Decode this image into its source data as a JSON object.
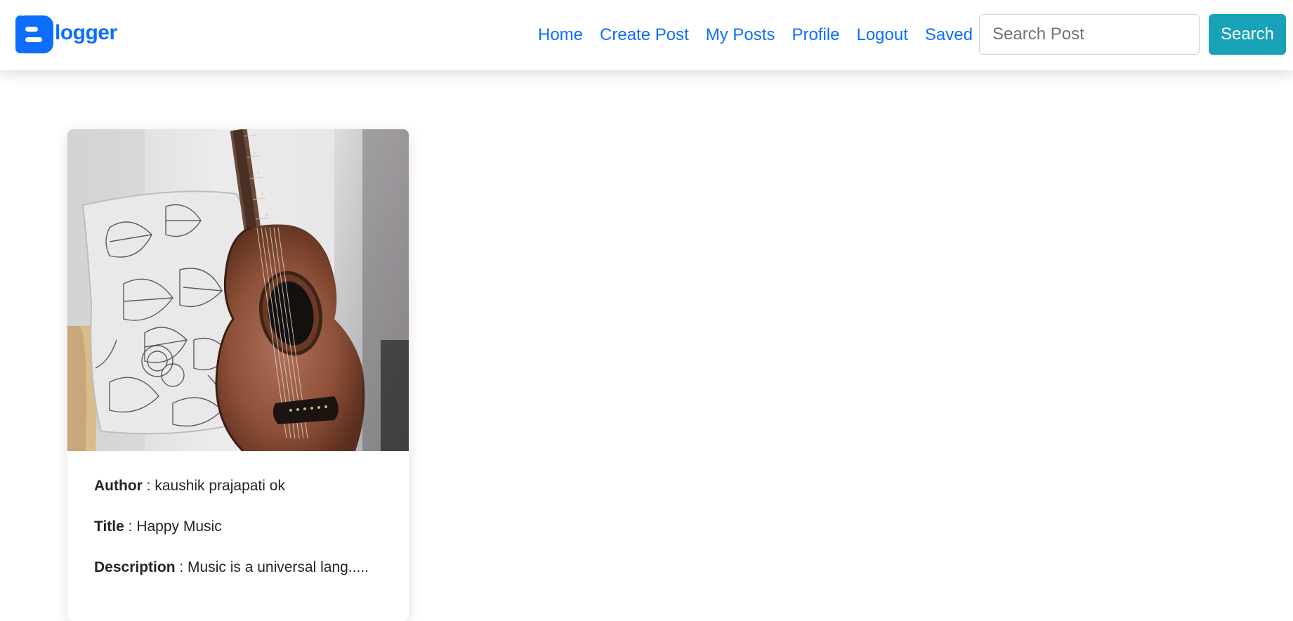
{
  "brand": {
    "name": "logger",
    "logo_icon": "blogger-logo-icon",
    "color": "#0d6efd"
  },
  "nav": {
    "items": [
      {
        "label": "Home"
      },
      {
        "label": "Create Post"
      },
      {
        "label": "My Posts"
      },
      {
        "label": "Profile"
      },
      {
        "label": "Logout"
      },
      {
        "label": "Saved"
      }
    ],
    "link_color": "#0d6efd"
  },
  "search": {
    "value": "",
    "placeholder": "Search Post",
    "button_label": "Search",
    "button_color": "#17a2b8"
  },
  "posts": [
    {
      "image_icon": "guitar-photo",
      "author_label": "Author",
      "author": "kaushik prajapati ok",
      "title_label": "Title",
      "title": "Happy Music",
      "description_label": "Description",
      "description": "Music is a universal lang....."
    }
  ],
  "separator": " : "
}
